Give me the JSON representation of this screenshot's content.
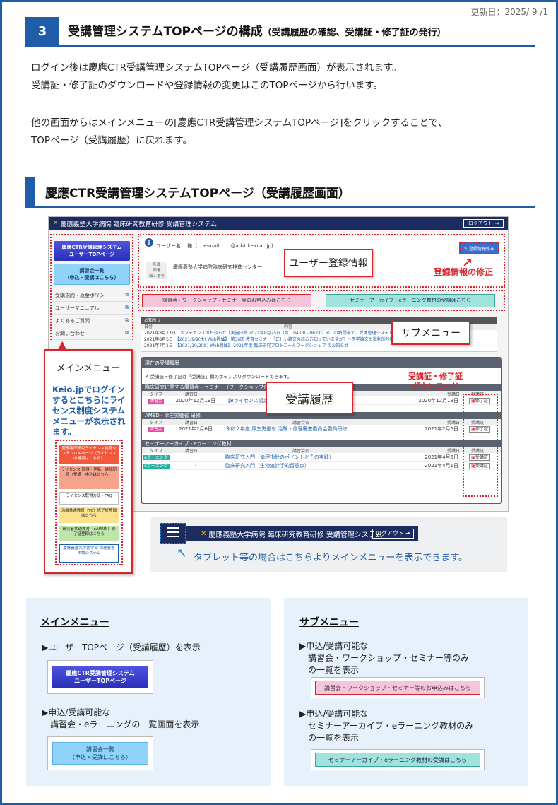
{
  "header": {
    "updated": "更新日：2025/ 9 /1",
    "section_number": "3",
    "section_title": "受講管理システムTOPページの構成",
    "section_subtitle": "（受講履歴の確認、受講証・修了証の発行）"
  },
  "intro": {
    "line1": "ログイン後は慶應CTR受講管理システムTOPページ（受講履歴画面）が表示されます。",
    "line2": "受講証・修了証のダウンロードや登録情報の変更はこのTOPページから行います。",
    "line3": "他の画面からはメインメニューの[慶應CTR受講管理システムTOPページ]をクリックすることで、",
    "line4": "TOPページ（受講履歴）に戻れます。"
  },
  "subheading": "慶應CTR受講管理システムTOPページ（受講履歴画面）",
  "screenshot": {
    "site_title": "慶應義塾大学病院 臨床研究教育研修 受講管理システム",
    "logout": "ログアウト",
    "side": {
      "top_btn_line1": "慶應CTR受講管理システム",
      "top_btn_line2": "ユーザーTOPページ",
      "list_btn_line1": "講習会一覧",
      "list_btn_line2": "（申込・受講はこちら）",
      "links": [
        "受講規約・返金ポリシー",
        "ユーザーマニュアル",
        "よくあるご質問",
        "お問い合わせ"
      ]
    },
    "user": {
      "name_label": "ユーザー名",
      "name_value": "様（",
      "email_label": "e-mail",
      "email_value": "@adst.keio.ac.jp)",
      "affil_label": "所属",
      "dept_label": "部署",
      "personal_label": "個人番号",
      "affil_value": "慶應義塾大学病院臨床研究推進センター",
      "edit_btn": "登録情報修正"
    },
    "submenu": {
      "workshop": "講習会・ワークショップ・セミナー等のお申込みはこちら",
      "archive": "セミナーアーカイブ・eラーニング教材の受講はこちら"
    },
    "news": {
      "title": "お知らせ",
      "col_date": "日付",
      "col_content": "内容",
      "rows": [
        {
          "date": "2021年8月13日",
          "text": "メンテナンスのお知らせ【実施日時 2021年8月25日（水）04:00 - 06:00】※この時間帯で、受講管理システムを使用"
        },
        {
          "date": "2021年8月5日",
          "text": "【2021/9/9(木) Web開催】 第36回 教育セミナー「正しい論文の読み方知っていますか？～医学論文の批判的吟味"
        },
        {
          "date": "2021年7月1日",
          "text": "【2021/10/2(土) Web開催】 2021年度 臨床研究プロトコールワークショップ のお知らせ"
        }
      ]
    },
    "history": {
      "title": "現在の受講履歴",
      "note": "✔ 受講証・修了証は「受講証」欄のボタンよりダウンロードできます。",
      "col_type": "タイプ",
      "col_date": "講習日",
      "col_name": "講習会名",
      "col_attend": "受講日",
      "col_cert": "受講証",
      "sections": [
        {
          "title": "臨床研究に関する講習会・セミナー（ワークショップ含む）",
          "rows": [
            {
              "type": "講習会",
              "date": "2020年12月19日",
              "name": "【Bライセンス認定】",
              "attend": "2020年12月19日",
              "cert": "修了証"
            }
          ]
        },
        {
          "title": "AMED・厚生労働省 研修",
          "rows": [
            {
              "type": "講習会",
              "date": "2021年2月6日",
              "name": "令和２年度 厚生労働省 治験・倫理審査委員会委員研修",
              "attend": "2021年2月6日",
              "cert": "修了証"
            }
          ]
        },
        {
          "title": "セミナーアーカイブ・eラーニング教材",
          "rows": [
            {
              "type": "eラーニング",
              "date": "-",
              "name": "臨床研究入門（倫理指針のポイントとその実践）",
              "attend": "2021年4月5日",
              "cert": "受講証"
            },
            {
              "type": "eラーニング",
              "date": "-",
              "name": "臨床研究入門（生物統計学的留意点）",
              "attend": "2021年4月1日",
              "cert": "受講証"
            }
          ]
        }
      ]
    }
  },
  "callouts": {
    "user_info": "ユーザー登録情報",
    "edit_info": "登録情報の修正",
    "submenu": "サブメニュー",
    "history": "受講履歴",
    "cert_dl_line1": "受講証・修了証",
    "cert_dl_line2": "ダウンロード",
    "main_menu": "メインメニュー",
    "keio_text": "Keio.jpでログインするとこちらにライセンス制度システムメニューが表示されます。"
  },
  "license_menu": [
    {
      "text": "慶應臨床研究ライセンス制度システムTOPページ（ライセンスの確認はこちら）",
      "bg": "#f05a3a",
      "fg": "#ffffff"
    },
    {
      "text": "ライセンス 取得・更新、継続研修（受講・申込はこちら）",
      "bg": "#f6a38c",
      "fg": "#222222"
    },
    {
      "text": "ライセンス取得方法・FAQ",
      "bg": "#ffffff",
      "fg": "#222222"
    },
    {
      "text": "治験共通教育（TC）修了証登録はこちら",
      "bg": "#fbe38d",
      "fg": "#222222"
    },
    {
      "text": "研究者共通教育（eAPRIN）修了証登録はこちら",
      "bg": "#bfe6a9",
      "fg": "#222222"
    },
    {
      "text": "慶應義塾大学医学部 倫理審査申請システム",
      "bg": "#ffffff",
      "fg": "#1f5da8"
    }
  ],
  "tablet": {
    "bar_title": "慶應義塾大学病院 臨床研究教育研修 受講管理システム",
    "logout": "ログアウト",
    "text": "タブレット等の場合はこちらよりメインメニューを表示できます。"
  },
  "panel_main": {
    "title": "メインメニュー",
    "item1": "▶ユーザーTOPページ（受講履歴）を表示",
    "btn1_line1": "慶應CTR受講管理システム",
    "btn1_line2": "ユーザーTOPページ",
    "item2_line1": "▶申込/受講可能な",
    "item2_line2": "講習会・eラーニングの一覧画面を表示",
    "btn2_line1": "講習会一覧",
    "btn2_line2": "（申込・受講はこちら）"
  },
  "panel_sub": {
    "title": "サブメニュー",
    "item1_line1": "▶申込/受講可能な",
    "item1_line2": "講習会・ワークショップ・セミナー等のみ",
    "item1_line3": "の一覧を表示",
    "btn1": "講習会・ワークショップ・セミナー等のお申込みはこちら",
    "item2_line1": "▶申込/受講可能な",
    "item2_line2": "セミナーアーカイブ・eラーニング教材のみ",
    "item2_line3": "の一覧を表示",
    "btn2": "セミナーアーカイブ・eラーニング教材の受講はこちら"
  }
}
